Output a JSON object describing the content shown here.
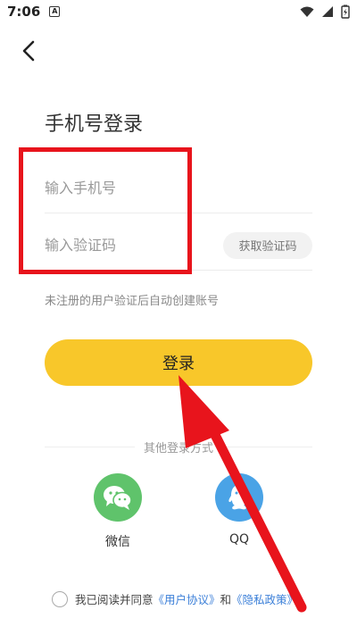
{
  "status_bar": {
    "time": "7:06",
    "notification_glyph": "A"
  },
  "page": {
    "title": "手机号登录"
  },
  "form": {
    "phone_placeholder": "输入手机号",
    "code_placeholder": "输入验证码",
    "get_code_label": "获取验证码",
    "hint": "未注册的用户验证后自动创建账号",
    "login_label": "登录"
  },
  "other_login": {
    "label": "其他登录方式",
    "options": [
      {
        "label": "微信",
        "icon": "wechat-icon",
        "color": "#5fc36b"
      },
      {
        "label": "QQ",
        "icon": "qq-icon",
        "color": "#4aa3e6"
      }
    ]
  },
  "agreement": {
    "prefix": "我已阅读并同意",
    "user_agreement": "《用户协议》",
    "conjunction": "和",
    "privacy_policy": "《隐私政策》"
  },
  "colors": {
    "accent": "#f8c72a",
    "link": "#3b7fd8",
    "annotation": "#e8141c"
  }
}
